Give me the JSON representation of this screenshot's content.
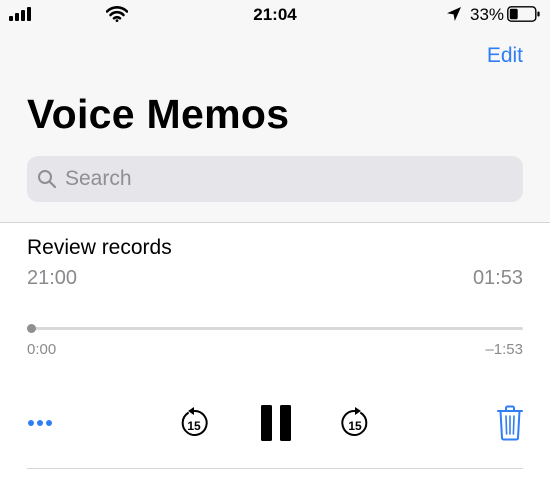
{
  "status_bar": {
    "time": "21:04",
    "battery_percent": "33%",
    "battery_level": 0.33,
    "icons": [
      "signal-icon",
      "wifi-icon",
      "location-icon",
      "battery-icon"
    ]
  },
  "header": {
    "edit_label": "Edit",
    "title": "Voice Memos"
  },
  "search": {
    "placeholder": "Search",
    "value": ""
  },
  "recording": {
    "title": "Review records",
    "time": "21:00",
    "duration": "01:53",
    "elapsed": "0:00",
    "remaining": "–1:53",
    "progress": 0.0
  },
  "controls": {
    "icons": [
      "more-icon",
      "skip-back-15-icon",
      "pause-icon",
      "skip-forward-15-icon",
      "trash-icon"
    ],
    "skip_seconds": "15"
  },
  "colors": {
    "accent": "#2f7ef6",
    "secondary_text": "#8a8a8e",
    "header_bg": "#f7f7f7",
    "search_bg": "#e5e5ea"
  }
}
